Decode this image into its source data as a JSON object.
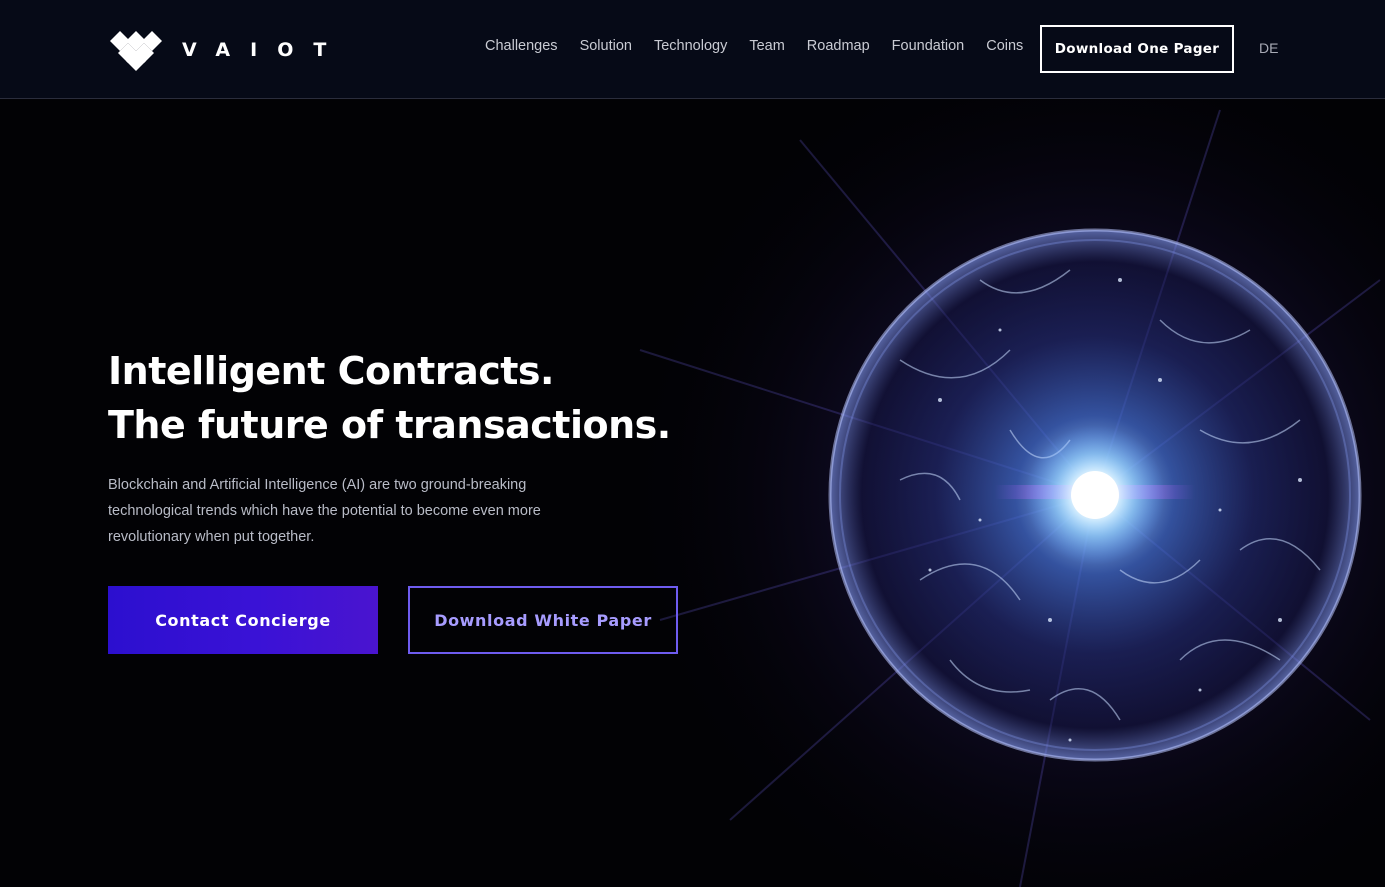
{
  "brand": {
    "name": "VAIOT",
    "logo_icon": "diamond-lattice-icon"
  },
  "nav": {
    "items": [
      {
        "label": "Challenges"
      },
      {
        "label": "Solution"
      },
      {
        "label": "Technology"
      },
      {
        "label": "Team"
      },
      {
        "label": "Roadmap"
      },
      {
        "label": "Foundation"
      },
      {
        "label": "Coins"
      }
    ],
    "cta_label": "Download One Pager",
    "language": "DE"
  },
  "hero": {
    "title_line1": "Intelligent Contracts.",
    "title_line2": "The future of transactions.",
    "description": "Blockchain and Artificial Intelligence (AI) are two ground-breaking technological trends which have the potential to become even more revolutionary when put together.",
    "primary_button": "Contact Concierge",
    "secondary_button": "Download White Paper"
  },
  "colors": {
    "header_bg": "#060a17",
    "page_bg": "#020205",
    "primary_button": "#3411d3",
    "secondary_border": "#6e5cf0",
    "secondary_text": "#a79cff"
  }
}
